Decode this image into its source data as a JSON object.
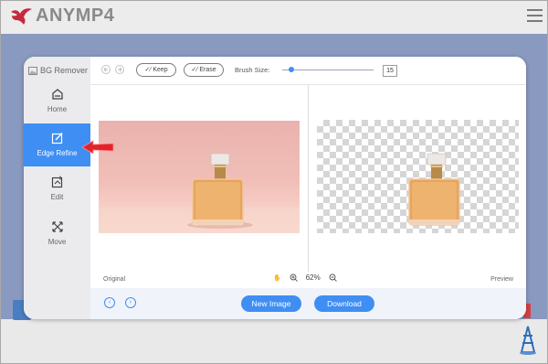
{
  "site": {
    "logo_text": "ANYMP4",
    "colors": {
      "brand_red": "#c8283c",
      "accent_blue": "#3f8ef4",
      "bg_band": "#8a99bf"
    }
  },
  "sidebar": {
    "title": "BG Remover",
    "items": [
      {
        "label": "Home",
        "icon": "home-icon"
      },
      {
        "label": "Edge Refine",
        "icon": "edge-refine-icon",
        "active": true
      },
      {
        "label": "Edit",
        "icon": "edit-icon"
      },
      {
        "label": "Move",
        "icon": "move-icon"
      }
    ]
  },
  "toolbar": {
    "keep_label": "Keep",
    "erase_label": "Erase",
    "brush_size_label": "Brush Size:",
    "brush_size_value": "15",
    "brush_size_slider_fraction": 0.1
  },
  "canvas": {
    "original_label": "Original",
    "preview_label": "Preview",
    "zoom_value": "62%"
  },
  "actions": {
    "new_image_label": "New Image",
    "download_label": "Download"
  }
}
